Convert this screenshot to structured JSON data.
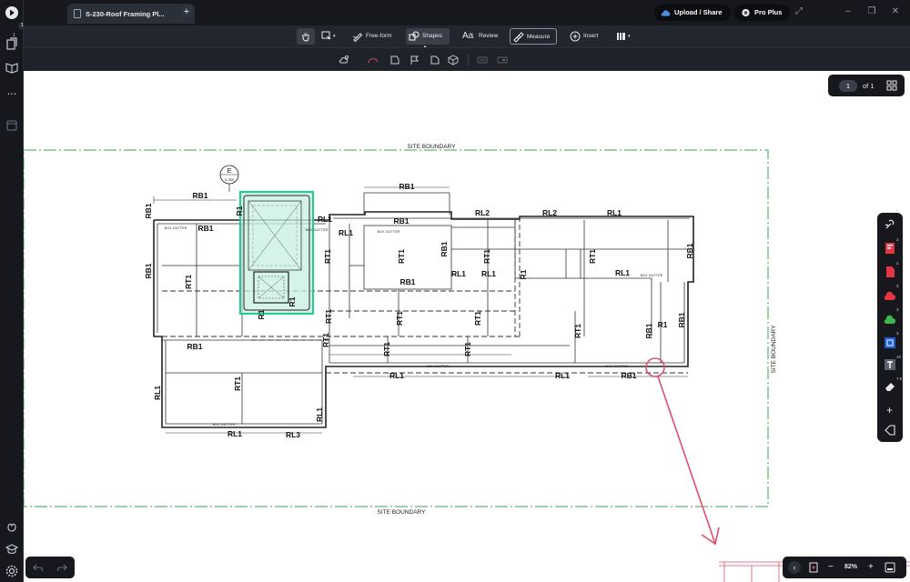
{
  "window": {
    "tab_title": "S-230-Roof Framing Pl...",
    "new_tab": "+",
    "upload_share": "Upload / Share",
    "pro_plus": "Pro Plus"
  },
  "left_rail": {
    "badge": "1",
    "more": "..."
  },
  "toolbar": {
    "freeform": "Free-form",
    "shapes": "Shapes",
    "review": "Review",
    "review_glyph": "Aa",
    "measure": "Measure",
    "insert": "Insert"
  },
  "pager": {
    "current_page": "1",
    "of_label": "of 1"
  },
  "zoom": {
    "level": "82%",
    "minus": "−",
    "plus": "+"
  },
  "palette": {
    "counts": [
      "2",
      "2",
      "3",
      "3",
      "3",
      "10",
      "7.5"
    ],
    "add": "+"
  },
  "drawing": {
    "site_boundary": "SITE BOUNDARY",
    "section_tag_letter": "E",
    "section_tag_sheet": "S.300",
    "box_gutter": "BOX GUTTER",
    "labels": {
      "RB1": "RB1",
      "R1": "R1",
      "RL1": "RL1",
      "RL2": "RL2",
      "RL3": "RL3",
      "RT1": "RT1"
    }
  },
  "colors": {
    "accent_green": "#2fc79a",
    "highlight_fill": "#c7f0df",
    "boundary_green": "#3aa64a",
    "markup_red": "#e0506a",
    "chrome_dark": "#16181d"
  }
}
